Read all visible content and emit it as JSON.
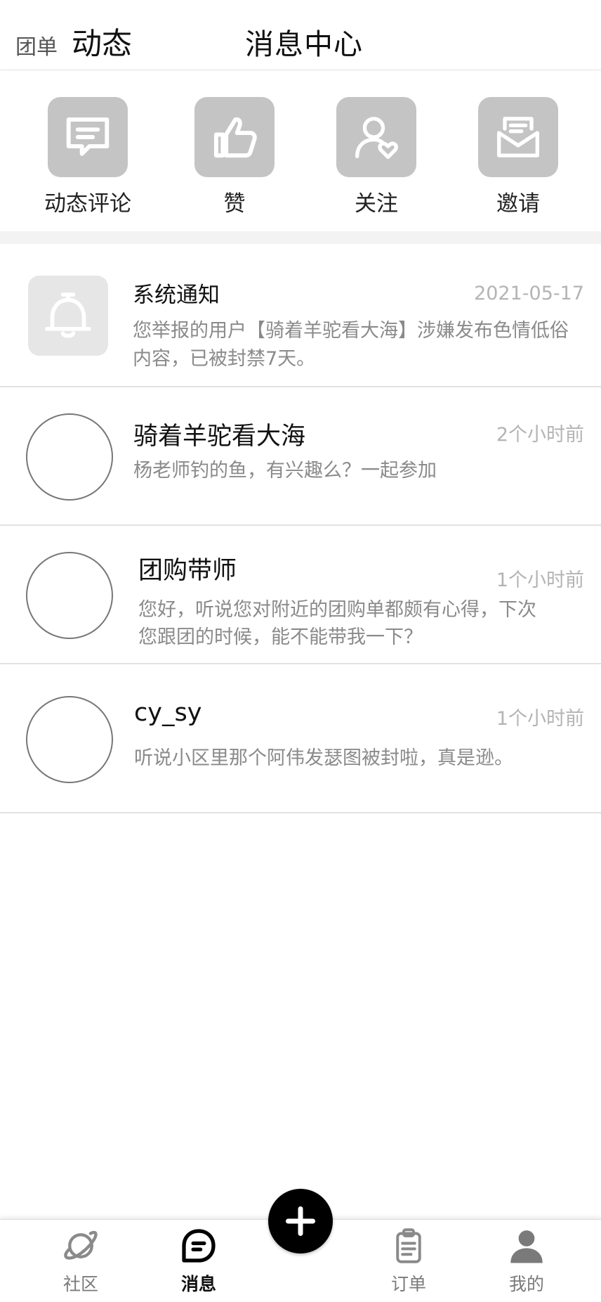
{
  "header": {
    "tab_small": "团单",
    "tab_active": "动态",
    "title": "消息中心"
  },
  "quick_actions": [
    {
      "label": "动态评论",
      "icon": "comment-icon"
    },
    {
      "label": "赞",
      "icon": "thumbs-up-icon"
    },
    {
      "label": "关注",
      "icon": "follow-user-icon"
    },
    {
      "label": "邀请",
      "icon": "invite-envelope-icon"
    }
  ],
  "messages": [
    {
      "name": "系统通知",
      "time": "2021-05-17",
      "preview_line1": "您举报的用户【骑着羊驼看大海】涉嫌发布色情低俗",
      "preview_line2": "内容，已被封禁7天。",
      "avatar": "bell-icon"
    },
    {
      "name": "骑着羊驼看大海",
      "time": "2个小时前",
      "preview_line1": "杨老师钓的鱼，有兴趣么？一起参加",
      "preview_line2": ""
    },
    {
      "name": "团购带师",
      "time": "1个小时前",
      "preview_line1": "您好，听说您对附近的团购单都颇有心得，下次",
      "preview_line2": "您跟团的时候，能不能带我一下？"
    },
    {
      "name": "cy_sy",
      "time": "1个小时前",
      "preview_line1": "听说小区里那个阿伟发瑟图被封啦，真是逊。",
      "preview_line2": ""
    }
  ],
  "bottom_nav": [
    {
      "label": "社区",
      "icon": "planet-icon"
    },
    {
      "label": "消息",
      "icon": "chat-bubble-icon",
      "active": true
    },
    {
      "label": "订单",
      "icon": "clipboard-icon"
    },
    {
      "label": "我的",
      "icon": "person-icon"
    }
  ],
  "fab": {
    "icon": "plus-icon"
  },
  "colors": {
    "icon_tile": "#c4c4c4",
    "system_avatar_bg": "#e6e6e6",
    "time_text": "#b4b4b4",
    "preview_text": "#8a8a8a",
    "fab_bg": "#000000"
  }
}
